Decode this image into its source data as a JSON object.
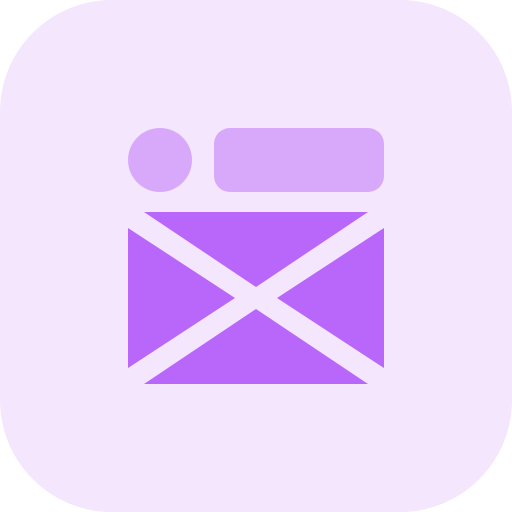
{
  "icon": {
    "name": "email-template-icon",
    "colors": {
      "background": "#F4E6FD",
      "light_accent": "#D8A8FA",
      "dark_accent": "#B966FA"
    }
  }
}
